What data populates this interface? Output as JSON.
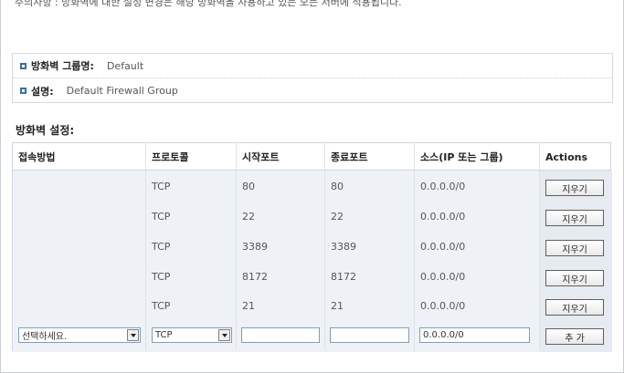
{
  "notice": "주의사항 : 방화벽에 대한 설정 변경은 해당 방화벽을 사용하고 있는 모든 서버에 적용됩니다.",
  "group": {
    "name_label": "방화벽 그룹명:",
    "name_value": "Default",
    "desc_label": "설명:",
    "desc_value": "Default Firewall Group"
  },
  "section_title": "방화벽 설정:",
  "table": {
    "headers": [
      "접속방법",
      "프로토콜",
      "시작포트",
      "종료포트",
      "소스(IP 또는 그룹)",
      "Actions"
    ],
    "rows": [
      {
        "method": "",
        "protocol": "TCP",
        "start": "80",
        "end": "80",
        "source": "0.0.0.0/0",
        "action": "지우기"
      },
      {
        "method": "",
        "protocol": "TCP",
        "start": "22",
        "end": "22",
        "source": "0.0.0.0/0",
        "action": "지우기"
      },
      {
        "method": "",
        "protocol": "TCP",
        "start": "3389",
        "end": "3389",
        "source": "0.0.0.0/0",
        "action": "지우기"
      },
      {
        "method": "",
        "protocol": "TCP",
        "start": "8172",
        "end": "8172",
        "source": "0.0.0.0/0",
        "action": "지우기"
      },
      {
        "method": "",
        "protocol": "TCP",
        "start": "21",
        "end": "21",
        "source": "0.0.0.0/0",
        "action": "지우기"
      }
    ],
    "new_row": {
      "method_select": "선택하세요.",
      "protocol_select": "TCP",
      "start_value": "",
      "end_value": "",
      "source_value": "0.0.0.0/0",
      "add_label": "추 가"
    }
  }
}
